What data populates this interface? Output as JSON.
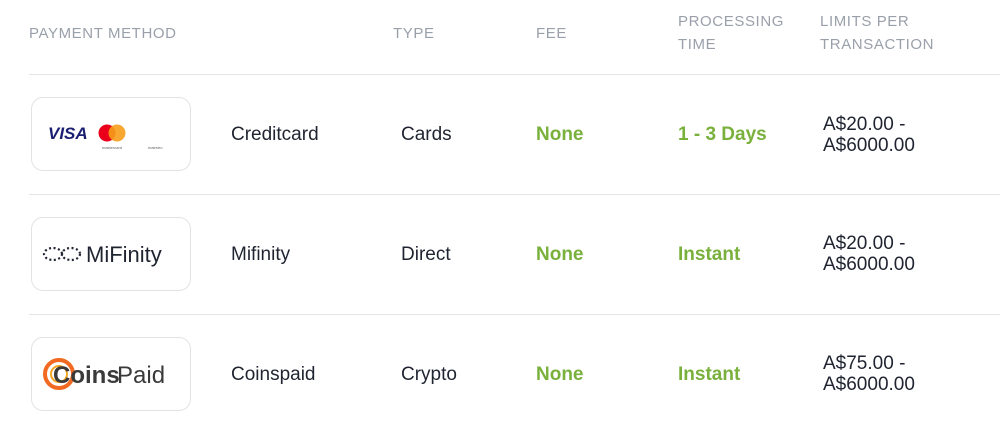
{
  "headers": {
    "payment_method": "PAYMENT METHOD",
    "type": "TYPE",
    "fee": "FEE",
    "processing_line1": "PROCESSING",
    "processing_line2": "TIME",
    "limits_line1": "LIMITS PER",
    "limits_line2": "TRANSACTION"
  },
  "rows": [
    {
      "logo": "visa-mastercard-maestro-logo",
      "logo_text": {
        "visa": "VISA",
        "mastercard": "mastercard",
        "maestro": "maestro"
      },
      "name": "Creditcard",
      "type": "Cards",
      "fee": "None",
      "processing": "1 - 3 Days",
      "limit_min": "A$20.00 -",
      "limit_max": "A$6000.00"
    },
    {
      "logo": "mifinity-logo",
      "logo_text": {
        "brand": "MiFinity"
      },
      "name": "Mifinity",
      "type": "Direct",
      "fee": "None",
      "processing": "Instant",
      "limit_min": "A$20.00 -",
      "limit_max": "A$6000.00"
    },
    {
      "logo": "coinspaid-logo",
      "logo_text": {
        "brand_a": "Coins",
        "brand_b": "Paid"
      },
      "name": "Coinspaid",
      "type": "Crypto",
      "fee": "None",
      "processing": "Instant",
      "limit_min": "A$75.00 -",
      "limit_max": "A$6000.00"
    }
  ],
  "colors": {
    "header_text": "#9aa0aa",
    "body_text": "#1f2430",
    "accent_green": "#7ab03c",
    "divider": "#e3e5e8",
    "visa_blue": "#1a1f71",
    "mc_red": "#eb001b",
    "mc_orange": "#f79e1b",
    "coinspaid_orange": "#f26a21"
  }
}
